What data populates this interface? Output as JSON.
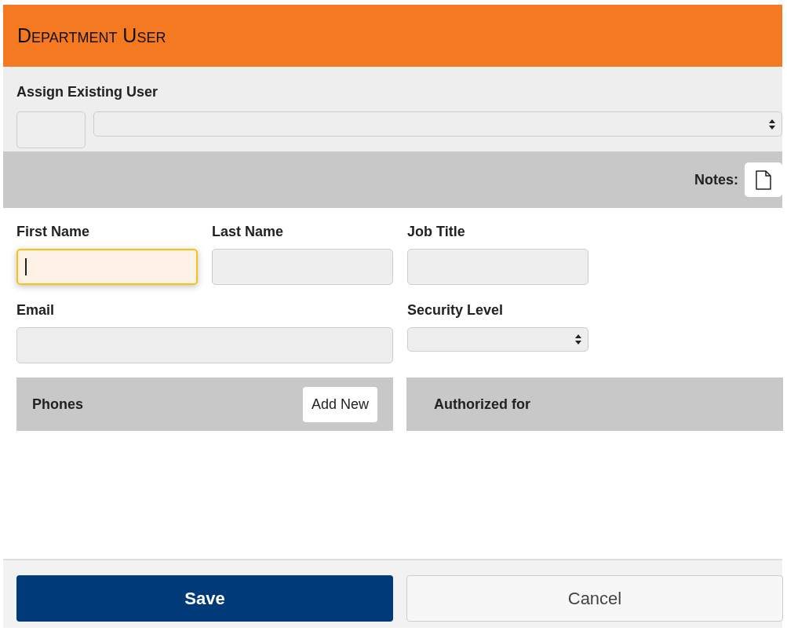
{
  "header": {
    "title": "Department User"
  },
  "assign": {
    "label": "Assign Existing User"
  },
  "notes": {
    "label": "Notes:"
  },
  "fields": [
    {
      "label": "First Name",
      "kind": "text",
      "focused": true
    },
    {
      "label": "Last Name",
      "kind": "text",
      "focused": false
    },
    {
      "label": "Job Title",
      "kind": "text",
      "focused": false
    },
    {
      "label": "Email",
      "kind": "wide",
      "focused": false
    },
    {
      "label": "Security Level",
      "kind": "select"
    }
  ],
  "panels": [
    {
      "title": "Phones",
      "button": "Add New"
    },
    {
      "title": "Authorized for"
    }
  ],
  "buttons": [
    {
      "label": "Save",
      "kind": "primary"
    },
    {
      "label": "Cancel",
      "kind": "secondary"
    }
  ]
}
